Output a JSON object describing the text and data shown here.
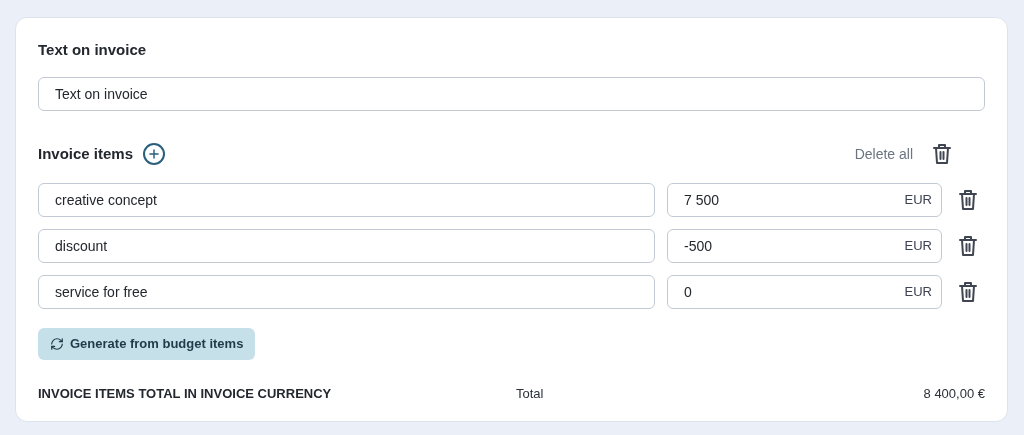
{
  "text_section": {
    "title": "Text on invoice",
    "field": {
      "value": "Text on invoice"
    }
  },
  "items_section": {
    "title": "Invoice items",
    "delete_all": "Delete all",
    "items": [
      {
        "name": "creative concept",
        "amount": "7 500",
        "currency": "EUR"
      },
      {
        "name": "discount",
        "amount": "-500",
        "currency": "EUR"
      },
      {
        "name": "service for free",
        "amount": "0",
        "currency": "EUR"
      }
    ],
    "generate_button": "Generate from budget items"
  },
  "total": {
    "label": "INVOICE ITEMS TOTAL IN INVOICE CURRENCY",
    "caption": "Total",
    "value": "8 400,00 €"
  }
}
